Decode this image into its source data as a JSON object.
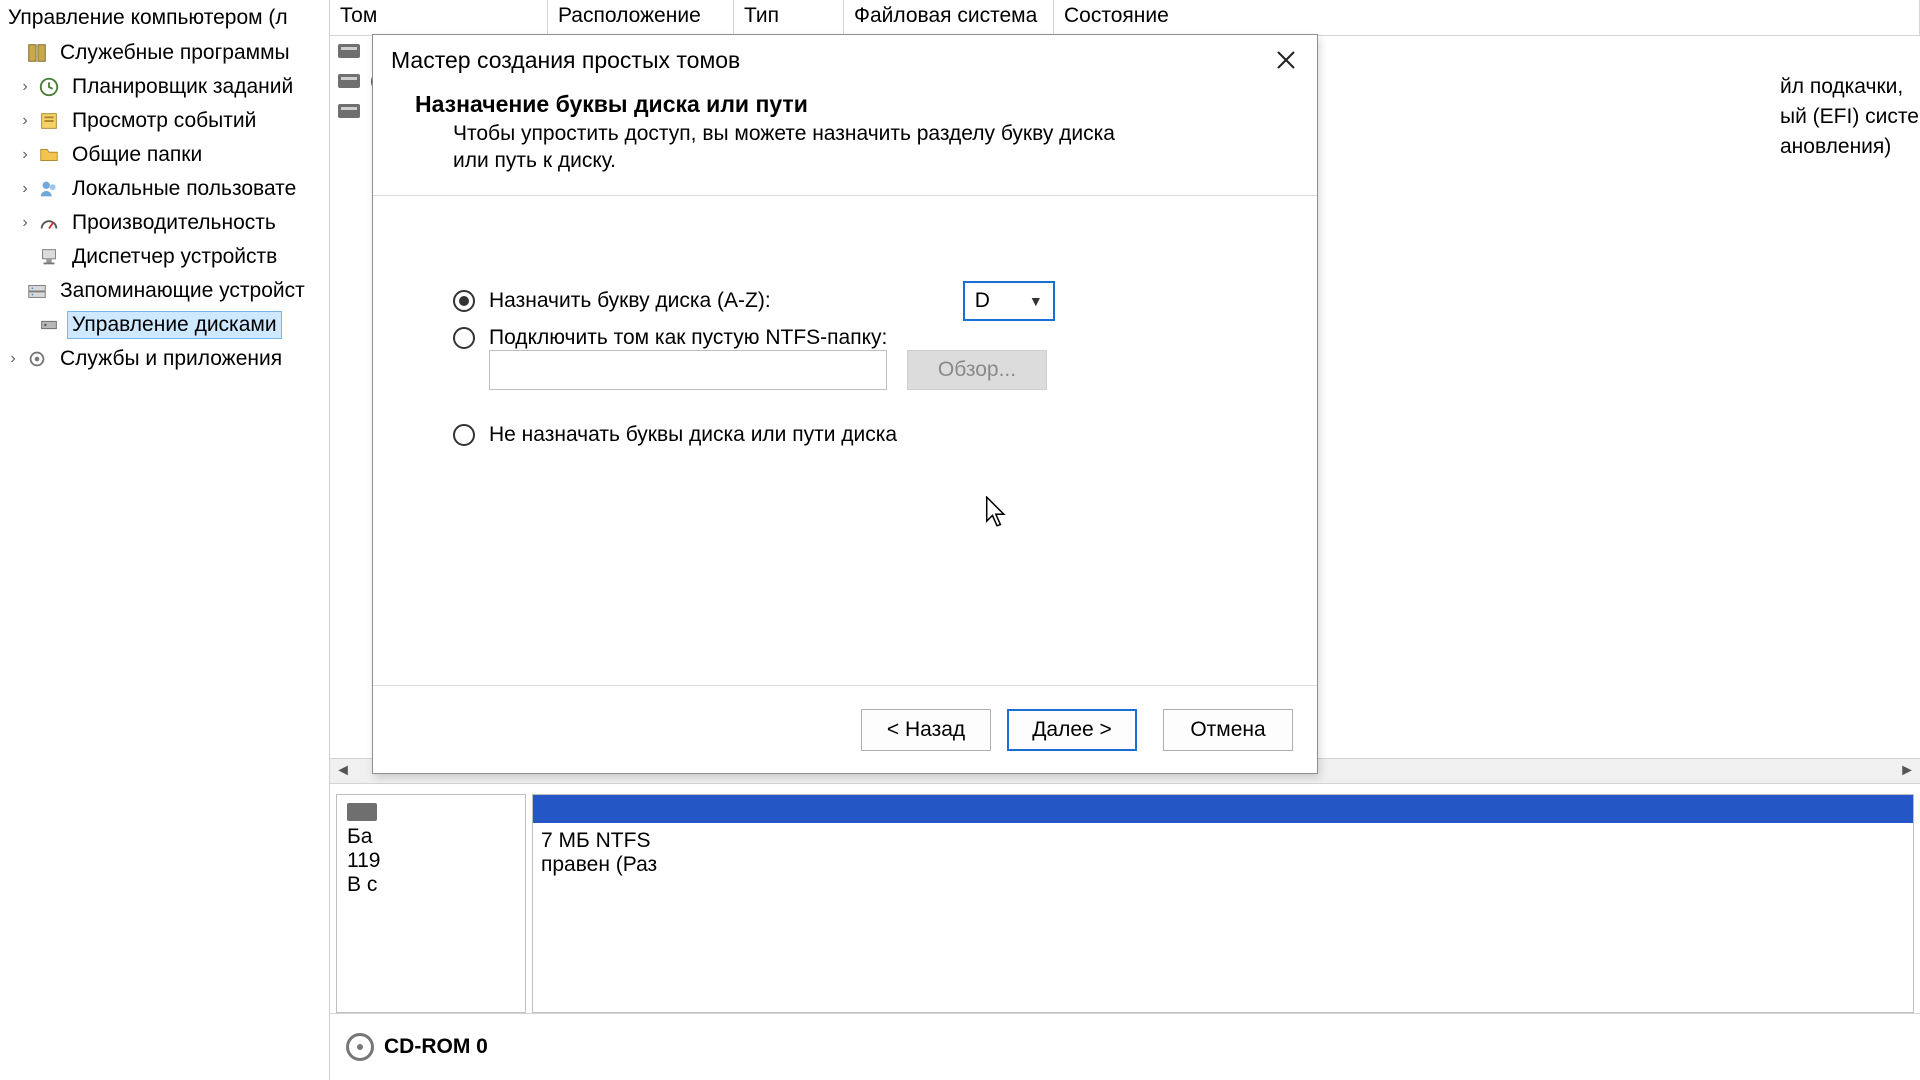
{
  "tree": {
    "root": "Управление компьютером (л",
    "utilities": "Служебные программы",
    "scheduler": "Планировщик заданий",
    "eventviewer": "Просмотр событий",
    "sharedfolders": "Общие папки",
    "localusers": "Локальные пользовате",
    "performance": "Производительность",
    "devmgr": "Диспетчер устройств",
    "storage": "Запоминающие устройст",
    "diskmgmt": "Управление дисками",
    "services": "Службы и приложения"
  },
  "columns": {
    "volume": "Том",
    "layout": "Расположение",
    "type": "Тип",
    "fs": "Файловая система",
    "status": "Состояние"
  },
  "vol_rows": {
    "r0": "",
    "r1": "(",
    "r2": ""
  },
  "status_tail": {
    "l1": "йл подкачки,",
    "l2": "ый (EFI) систе",
    "l3": "ановления)"
  },
  "disk0": {
    "l1": "Ба",
    "l2": "119",
    "l3": "В с"
  },
  "part0": {
    "l1": "7 МБ NTFS",
    "l2": "правен (Раз"
  },
  "cdrom": "CD-ROM 0",
  "wizard": {
    "title": "Мастер создания простых томов",
    "heading": "Назначение буквы диска или пути",
    "sub": "Чтобы упростить доступ, вы можете назначить разделу букву диска или путь к диску.",
    "opt_assign": "Назначить букву диска (A-Z):",
    "selected_letter": "D",
    "opt_mount": "Подключить том как пустую NTFS-папку:",
    "browse": "Обзор...",
    "opt_none": "Не назначать буквы диска или пути диска",
    "back": "< Назад",
    "next": "Далее >",
    "cancel": "Отмена"
  }
}
